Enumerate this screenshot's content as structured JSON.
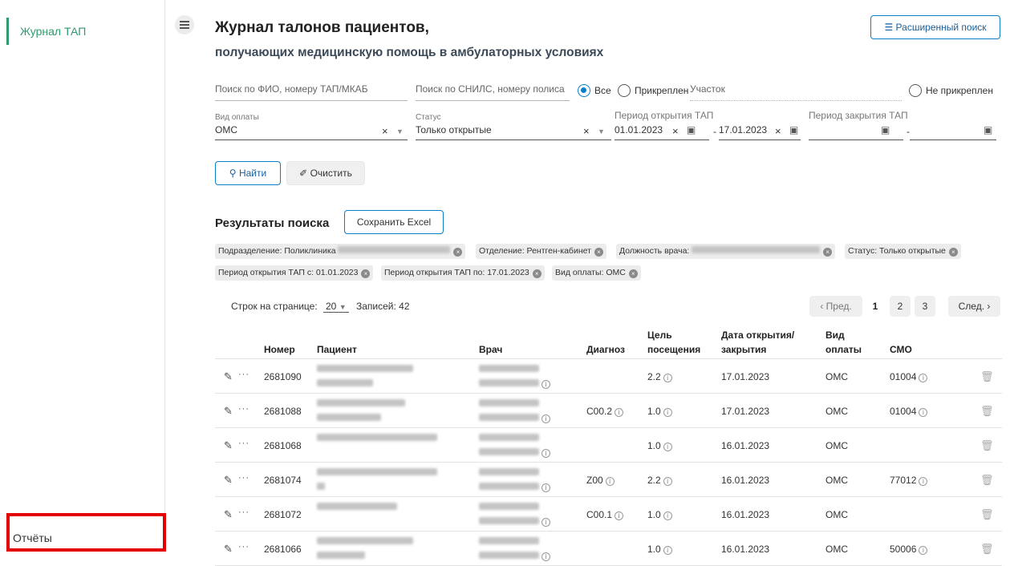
{
  "sidebar": {
    "active_item": "Журнал ТАП",
    "bottom_item": "Отчёты"
  },
  "header": {
    "title": "Журнал талонов пациентов,",
    "subtitle": "получающих медицинскую помощь в амбулаторных условиях",
    "ext_search_label": "Расширенный поиск"
  },
  "filters": {
    "fio_placeholder": "Поиск по ФИО, номеру ТАП/МКАБ",
    "snils_placeholder": "Поиск по СНИЛС, номеру полиса",
    "radio_all": "Все",
    "radio_attached": "Прикреплен",
    "uchastok_placeholder": "Участок",
    "radio_not_attached": "Не прикреплен",
    "payment_label": "Вид оплаты",
    "payment_value": "ОМС",
    "status_label": "Статус",
    "status_value": "Только открытые",
    "open_period_label": "Период открытия ТАП",
    "open_from": "01.01.2023",
    "open_to": "17.01.2023",
    "close_period_label": "Период закрытия ТАП",
    "dash": "-",
    "find_label": "Найти",
    "clear_label": "Очистить"
  },
  "results": {
    "title": "Результаты поиска",
    "excel_label": "Сохранить Excel",
    "chips": {
      "division": "Подразделение: Поликлиника",
      "department": "Отделение: Рентген-кабинет",
      "position": "Должность врача:",
      "status": "Статус: Только открытые",
      "open_from": "Период открытия ТАП с: 01.01.2023",
      "open_to": "Период открытия ТАП по: 17.01.2023",
      "payment": "Вид оплаты: ОМС"
    },
    "rows_per_page_label": "Строк на странице:",
    "rows_per_page_value": "20",
    "records_label": "Записей:",
    "records_value": "42",
    "pager": {
      "prev": "‹ Пред.",
      "p1": "1",
      "p2": "2",
      "p3": "3",
      "next": "След. ›"
    }
  },
  "table": {
    "headers": {
      "number": "Номер",
      "patient": "Пациент",
      "doctor": "Врач",
      "diagnosis": "Диагноз",
      "goal_1": "Цель",
      "goal_2": "посещения",
      "date_1": "Дата открытия/",
      "date_2": "закрытия",
      "pay_1": "Вид",
      "pay_2": "оплаты",
      "smo": "СМО"
    },
    "rows": [
      {
        "number": "2681090",
        "diagnosis": "",
        "goal": "2.2",
        "date": "17.01.2023",
        "payment": "ОМС",
        "smo": "01004"
      },
      {
        "number": "2681088",
        "diagnosis": "C00.2",
        "goal": "1.0",
        "date": "17.01.2023",
        "payment": "ОМС",
        "smo": "01004"
      },
      {
        "number": "2681068",
        "diagnosis": "",
        "goal": "1.0",
        "date": "16.01.2023",
        "payment": "ОМС",
        "smo": ""
      },
      {
        "number": "2681074",
        "diagnosis": "Z00",
        "goal": "2.2",
        "date": "16.01.2023",
        "payment": "ОМС",
        "smo": "77012"
      },
      {
        "number": "2681072",
        "diagnosis": "C00.1",
        "goal": "1.0",
        "date": "16.01.2023",
        "payment": "ОМС",
        "smo": ""
      },
      {
        "number": "2681066",
        "diagnosis": "",
        "goal": "1.0",
        "date": "16.01.2023",
        "payment": "ОМС",
        "smo": "50006"
      }
    ]
  },
  "colors": {
    "accent": "#0a7fc7",
    "active_nav": "#2e9a6e",
    "highlight_box": "#e40000"
  }
}
